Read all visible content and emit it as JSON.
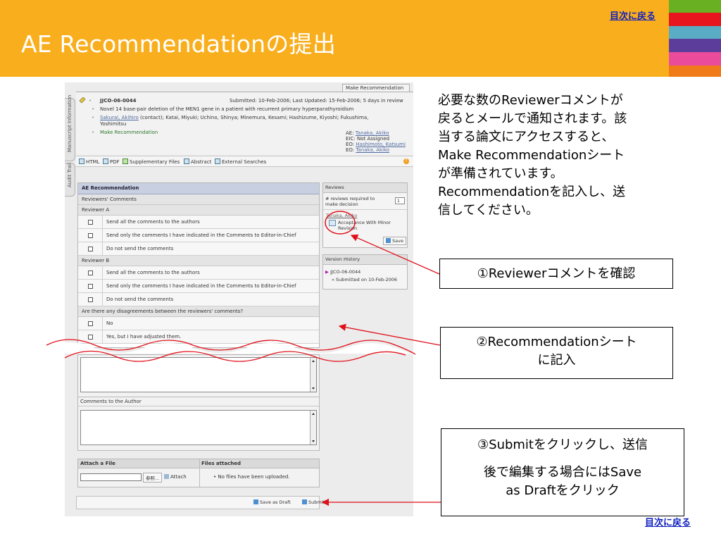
{
  "slide": {
    "title": "AE Recommendationの提出",
    "toc_link": "目次に戻る",
    "stripe_colors": [
      "#6ab023",
      "#e8141e",
      "#5aacc4",
      "#5d3d9c",
      "#ea4c9b",
      "#f07a1a"
    ],
    "accent_color": "#f9ae1d"
  },
  "app": {
    "side_tabs": [
      "Manuscript Information",
      "Audit Trail"
    ],
    "top_tab": "Make Recommendation",
    "manuscript": {
      "id": "JJCO-06-0044",
      "submitted": "Submitted: 10-Feb-2006; Last Updated: 15-Feb-2006; 5 days in review",
      "title": "Novel 14 base-pair deletion of the MEN1 gene in a patient with recurrent primary hyperparathyroidism",
      "authors_link": "Sakurai, Akihiro",
      "authors_rest": " (contact); Katai, Miyuki; Uchino, Shinya; Minemura, Kesami; Hashizume, Kiyoshi; Fukushima,",
      "authors_line2": "Yoshimitsu",
      "action": "Make Recommendation",
      "ae_label": "AE: ",
      "ae_name": "Tanaka, Akiko",
      "eic": "EIC: Not Assigned",
      "eo1_label": "EO: ",
      "eo1_name": "Hashimoto, Katsumi",
      "eo2_label": "EO: ",
      "eo2_name": "Tanaka, Akiko"
    },
    "toolbar": [
      "HTML",
      "PDF",
      "Supplementary Files",
      "Abstract",
      "External Searches"
    ],
    "toolbar_help": "?",
    "ae_panel": {
      "title": "AE Recommendation",
      "reviewers_comments": "Reviewers' Comments",
      "reviewer_a": "Reviewer A",
      "reviewer_b": "Reviewer B",
      "options": [
        "Send all the comments to the authors",
        "Send only the comments I have indicated in the Comments to Editor-in-Chief",
        "Do not send the comments"
      ],
      "disagreement_q": "Are there any disagreements between the reviewers' comments?",
      "disagreement_opts": [
        "No",
        "Yes, but I have adjusted them."
      ]
    },
    "reviews_box": {
      "title": "Reviews",
      "required_label": "# reviews required to make decision",
      "required_value": "1",
      "reviewer": "Tanaka, Akiko",
      "decision": "Acceptance With Minor Revision",
      "save": "Save"
    },
    "version_box": {
      "title": "Version History",
      "ms": "JJCO-06-0044",
      "submitted": "Submitted on 10-Feb-2006"
    },
    "comments_author": "Comments to the Author",
    "attach": {
      "title": "Attach a File",
      "browse": "参照...",
      "attach_btn": "Attach",
      "files_title": "Files attached",
      "files_status": "No files have been uploaded."
    },
    "buttons": {
      "save_draft": "Save as Draft",
      "submit": "Submit"
    }
  },
  "description": [
    "必要な数のReviewerコメントが",
    "戻るとメールで通知されます。該",
    "当する論文にアクセスすると、",
    "Make Recommendationシート",
    "が準備されています。",
    "Recommendationを記入し、送",
    "信してください。"
  ],
  "callouts": {
    "c1": "①Reviewerコメントを確認",
    "c2_l1": "②Recommendationシート",
    "c2_l2": "に記入",
    "c3_l1": "③Submitをクリックし、送信",
    "c3_l2": "後で編集する場合にはSave",
    "c3_l3": "as Draftをクリック"
  }
}
